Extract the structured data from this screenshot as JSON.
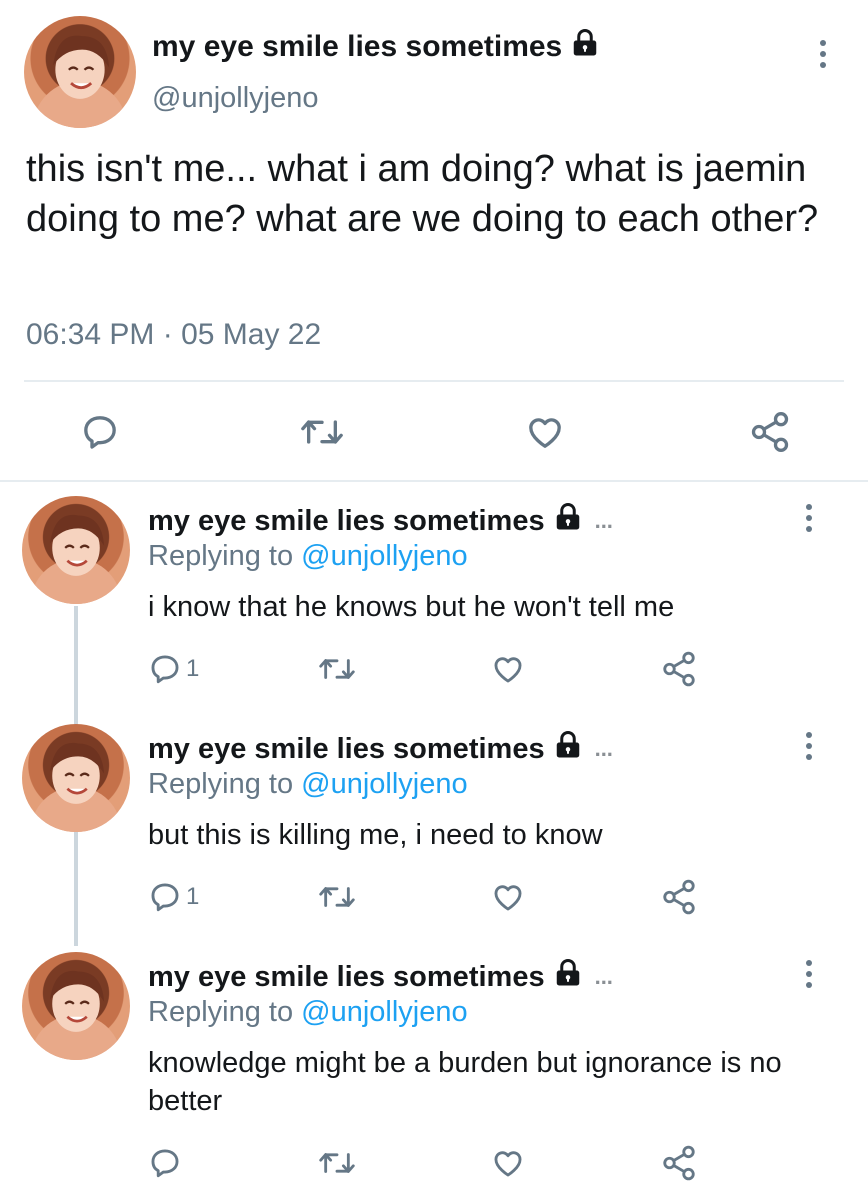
{
  "main_tweet": {
    "display_name": "my eye smile lies sometimes",
    "handle": "@unjollyjeno",
    "text": "this isn't me... what i am doing? what is jaemin doing to me? what are we doing to each other?",
    "timestamp": "06:34 PM · 05 May 22"
  },
  "replies": [
    {
      "display_name": "my eye smile lies sometimes",
      "ellipsis": "...",
      "replying_prefix": "Replying to ",
      "replying_handle": "@unjollyjeno",
      "text": "i know that he knows but he won't tell me",
      "reply_count": "1"
    },
    {
      "display_name": "my eye smile lies sometimes",
      "ellipsis": "...",
      "replying_prefix": "Replying to ",
      "replying_handle": "@unjollyjeno",
      "text": "but this is killing me, i need to know",
      "reply_count": "1"
    },
    {
      "display_name": "my eye smile lies sometimes",
      "ellipsis": "...",
      "replying_prefix": "Replying to ",
      "replying_handle": "@unjollyjeno",
      "text": "knowledge might be a burden but ignorance is no better",
      "reply_count": ""
    }
  ],
  "icons": {
    "reply": "reply-icon",
    "retweet": "retweet-icon",
    "like": "heart-icon",
    "share": "share-icon",
    "lock": "lock-icon",
    "more": "more-options-icon"
  },
  "colors": {
    "text": "#14171a",
    "secondary": "#657786",
    "link": "#1da1f2",
    "divider": "#e6ecf0"
  }
}
